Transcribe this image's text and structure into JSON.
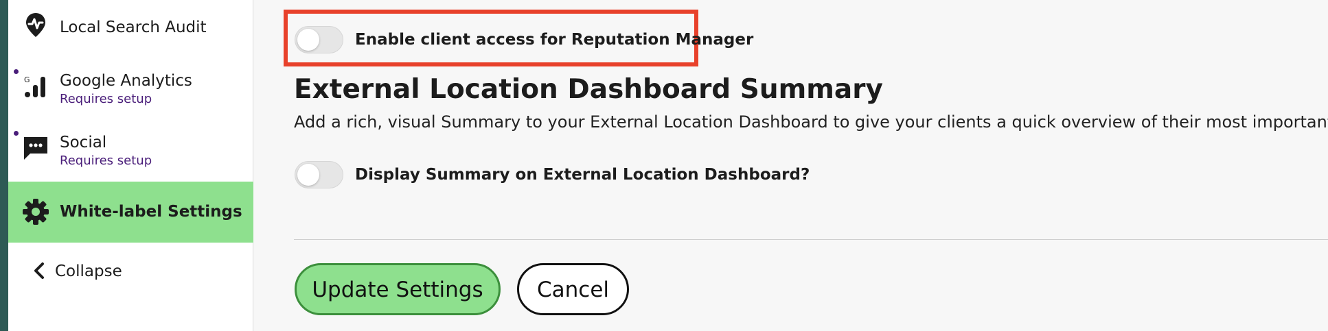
{
  "sidebar": {
    "items": [
      {
        "label": "Local Search Audit",
        "icon": "map-pin-pulse-icon"
      },
      {
        "label": "Google Analytics",
        "sub": "Requires setup",
        "icon": "analytics-bars-icon"
      },
      {
        "label": "Social",
        "sub": "Requires setup",
        "icon": "chat-bubble-icon"
      },
      {
        "label": "White-label Settings",
        "icon": "gear-icon",
        "active": true
      },
      {
        "label": "Collapse",
        "icon": "chevron-left-icon"
      }
    ]
  },
  "main": {
    "reputation_toggle": {
      "label": "Enable client access for Reputation Manager",
      "on": false
    },
    "summary": {
      "title": "External Location Dashboard Summary",
      "description": "Add a rich, visual Summary to your External Location Dashboard to give your clients a quick overview of their most important KPIs.",
      "toggle_label": "Display Summary on External Location Dashboard?",
      "toggle_on": false
    },
    "actions": {
      "update_label": "Update Settings",
      "cancel_label": "Cancel"
    }
  },
  "colors": {
    "active_bg": "#8ee08e",
    "accent_purple": "#4a1e7a",
    "highlight_red": "#e8412b",
    "edge_teal": "#2e5a55"
  }
}
